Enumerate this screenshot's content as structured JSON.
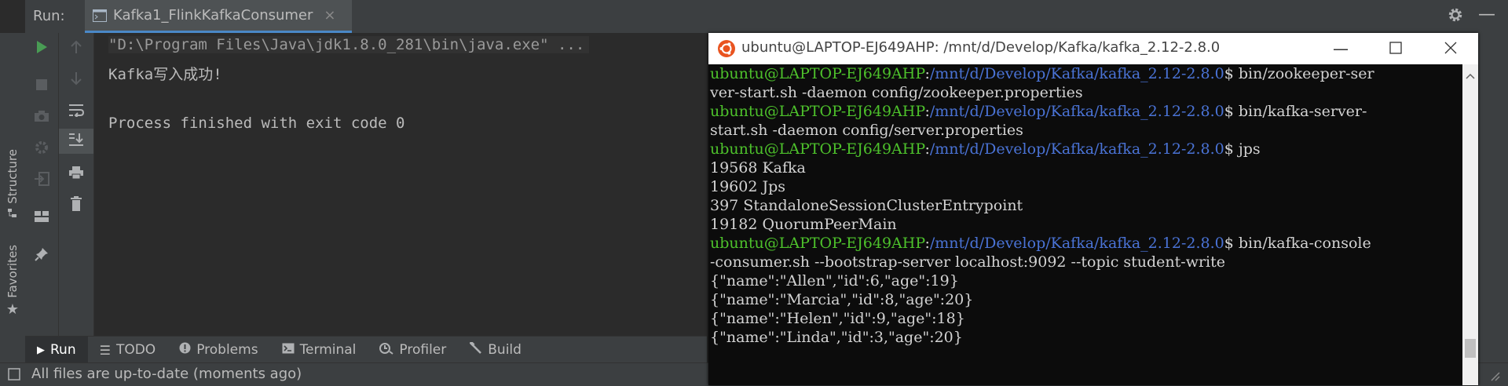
{
  "run_header": {
    "label": "Run:",
    "tab_title": "Kafka1_FlinkKafkaConsumer",
    "tab_close": "×"
  },
  "left_strip": {
    "structure": "Structure",
    "favorites": "Favorites"
  },
  "console": {
    "command": "\"D:\\Program Files\\Java\\jdk1.8.0_281\\bin\\java.exe\" ...",
    "output": "Kafka写入成功!",
    "exit": "Process finished with exit code 0"
  },
  "bottom_tabs": {
    "run": "Run",
    "todo": "TODO",
    "problems": "Problems",
    "terminal": "Terminal",
    "profiler": "Profiler",
    "build": "Build"
  },
  "status_bar": {
    "text": "All files are up-to-date (moments ago)"
  },
  "terminal": {
    "title": "ubuntu@LAPTOP-EJ649AHP: /mnt/d/Develop/Kafka/kafka_2.12-2.8.0",
    "user_host": "ubuntu@LAPTOP-EJ649AHP",
    "colon": ":",
    "path": "/mnt/d/Develop/Kafka/kafka_2.12-2.8.0",
    "prompt_sign": "$ ",
    "cmd1": "bin/zookeeper-ser",
    "cmd1_cont": "ver-start.sh -daemon config/zookeeper.properties",
    "cmd2": "bin/kafka-server-",
    "cmd2_cont": "start.sh -daemon config/server.properties",
    "cmd3": "jps",
    "jps_lines": [
      "19568 Kafka",
      "19602 Jps",
      "397 StandaloneSessionClusterEntrypoint",
      "19182 QuorumPeerMain"
    ],
    "cmd4": "bin/kafka-console",
    "cmd4_cont": "-consumer.sh --bootstrap-server localhost:9092 --topic student-write",
    "records": [
      "{\"name\":\"Allen\",\"id\":6,\"age\":19}",
      "{\"name\":\"Marcia\",\"id\":8,\"age\":20}",
      "{\"name\":\"Helen\",\"id\":9,\"age\":18}",
      "{\"name\":\"Linda\",\"id\":3,\"age\":20}"
    ]
  },
  "colors": {
    "ide_bg": "#2b2b2b",
    "panel_bg": "#3c3f41",
    "run_green": "#499c54",
    "term_green": "#4dc12b",
    "term_blue": "#4a73d6",
    "ubuntu_orange": "#e95420"
  }
}
